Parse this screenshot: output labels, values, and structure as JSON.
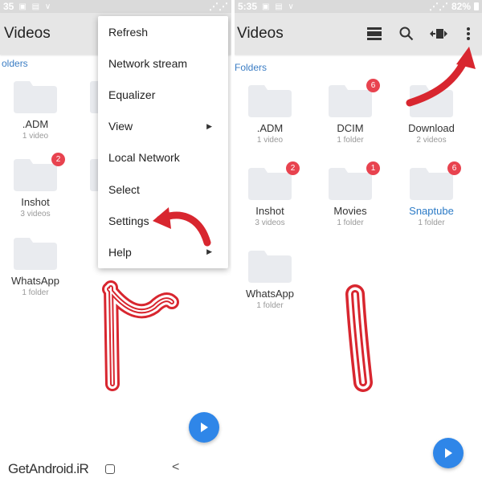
{
  "colors": {
    "accent": "#3b7dc4",
    "badge": "#e8434f",
    "fab": "#2f86e8",
    "annotation": "#d8262f",
    "folder": "#e9ebef"
  },
  "status_bar": {
    "left_time": "35",
    "right_time": "5:35",
    "battery": "82%"
  },
  "left_panel": {
    "title": "Videos",
    "section_label": "olders",
    "folders": [
      {
        "name": ".ADM",
        "sub": "1 video",
        "badge": ""
      },
      {
        "name": "Inshot",
        "sub": "3 videos",
        "badge": "2"
      },
      {
        "name": "WhatsApp",
        "sub": "1 folder",
        "badge": ""
      }
    ],
    "menu": [
      {
        "label": "Refresh",
        "submenu": false
      },
      {
        "label": "Network stream",
        "submenu": false
      },
      {
        "label": "Equalizer",
        "submenu": false
      },
      {
        "label": "View",
        "submenu": true
      },
      {
        "label": "Local Network",
        "submenu": false
      },
      {
        "label": "Select",
        "submenu": false
      },
      {
        "label": "Settings",
        "submenu": false
      },
      {
        "label": "Help",
        "submenu": true
      }
    ],
    "annotation_numeral": "۲",
    "icons": {
      "play": "play-icon",
      "submenu": "chevron-right-icon"
    }
  },
  "right_panel": {
    "title": "Videos",
    "section_label": "Folders",
    "toolbar_icons": [
      "view-mode-icon",
      "search-icon",
      "cast-icon",
      "more-vert-icon"
    ],
    "folders": [
      {
        "name": ".ADM",
        "sub": "1 video",
        "badge": ""
      },
      {
        "name": "DCIM",
        "sub": "1 folder",
        "badge": "6"
      },
      {
        "name": "Download",
        "sub": "2 videos",
        "badge": ""
      },
      {
        "name": "Inshot",
        "sub": "3 videos",
        "badge": "2"
      },
      {
        "name": "Movies",
        "sub": "1 folder",
        "badge": "1"
      },
      {
        "name": "Snaptube",
        "sub": "1 folder",
        "badge": "6"
      },
      {
        "name": "WhatsApp",
        "sub": "1 folder",
        "badge": ""
      }
    ],
    "annotation_numeral": "۱"
  },
  "watermark": "GetAndroid.iR"
}
